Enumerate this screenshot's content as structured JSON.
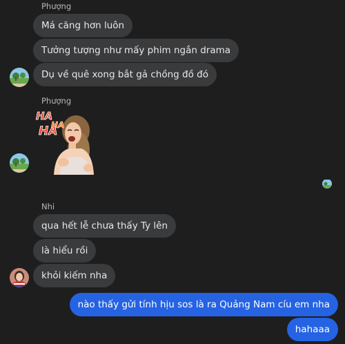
{
  "thread": {
    "group1": {
      "sender": "Phượng",
      "messages": [
        "Má căng hơn luôn",
        "Tưởng tượng như mấy phim ngắn drama",
        "Dụ về quê xong bắt gả chồng đồ đó"
      ]
    },
    "group2": {
      "sender": "Phượng",
      "sticker": {
        "text_top": "HA",
        "text_mid": "HA",
        "text_side": "HA"
      }
    },
    "group3": {
      "sender": "Nhi",
      "messages": [
        "qua hết lễ chưa thấy Ty lên",
        "là hiểu rồi",
        "khỏi kiếm nha"
      ]
    },
    "outgoing": {
      "messages": [
        "nào thấy gửi tính hịu sos là ra Quảng Nam cíu em nha",
        "hahaaa"
      ]
    }
  },
  "colors": {
    "background": "#1e1e1f",
    "incoming_bubble": "#3a3b3c",
    "outgoing_bubble": "#2563e3",
    "sender_text": "#b8b8b8"
  },
  "icons": {
    "avatar_phuong": "landscape-avatar",
    "avatar_nhi": "person-avatar",
    "seen_receipt": "seen-avatar"
  }
}
